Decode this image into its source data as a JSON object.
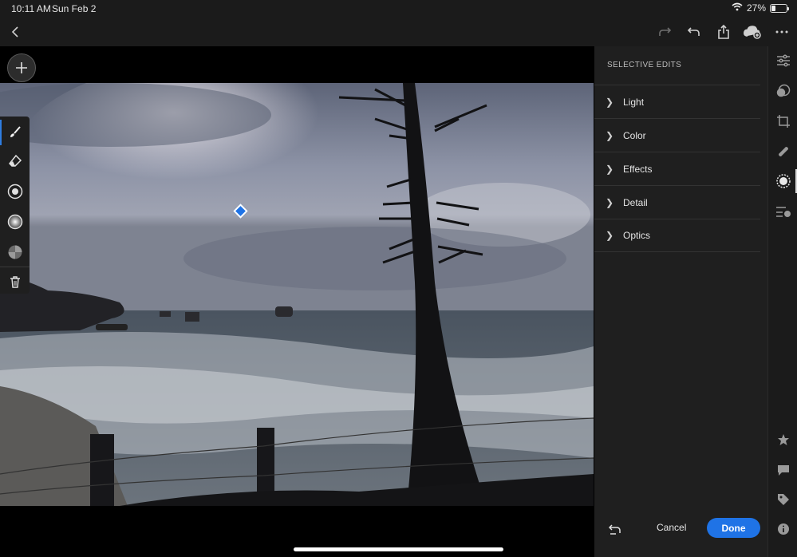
{
  "status_bar": {
    "time": "10:11 AM",
    "date": "Sun Feb 2",
    "battery_percent": "27%",
    "battery_level": 0.27,
    "icons": [
      "wifi-icon",
      "battery-icon"
    ]
  },
  "toolbar": {
    "left": [
      "back-icon"
    ],
    "right": [
      "redo-icon",
      "undo-icon",
      "share-icon",
      "cloud-sync-icon",
      "more-icon"
    ]
  },
  "tools": [
    "brush-icon",
    "eraser-icon",
    "radial-gradient-icon",
    "linear-gradient-icon",
    "color-range-icon",
    "delete-icon"
  ],
  "panel": {
    "title": "SELECTIVE EDITS",
    "sections": [
      {
        "label": "Light"
      },
      {
        "label": "Color"
      },
      {
        "label": "Effects"
      },
      {
        "label": "Detail"
      },
      {
        "label": "Optics"
      }
    ],
    "cancel_label": "Cancel",
    "done_label": "Done"
  },
  "rail": {
    "top": [
      "edit-sliders-icon",
      "presets-icon",
      "crop-icon",
      "healing-icon",
      "selective-icon",
      "versions-icon"
    ],
    "bottom": [
      "star-icon",
      "comment-icon",
      "tag-icon",
      "info-icon"
    ],
    "active": "selective-icon"
  },
  "colors": {
    "accent": "#1f73e6",
    "panel_bg": "#1f1f1f",
    "chrome_bg": "#1b1b1b"
  }
}
